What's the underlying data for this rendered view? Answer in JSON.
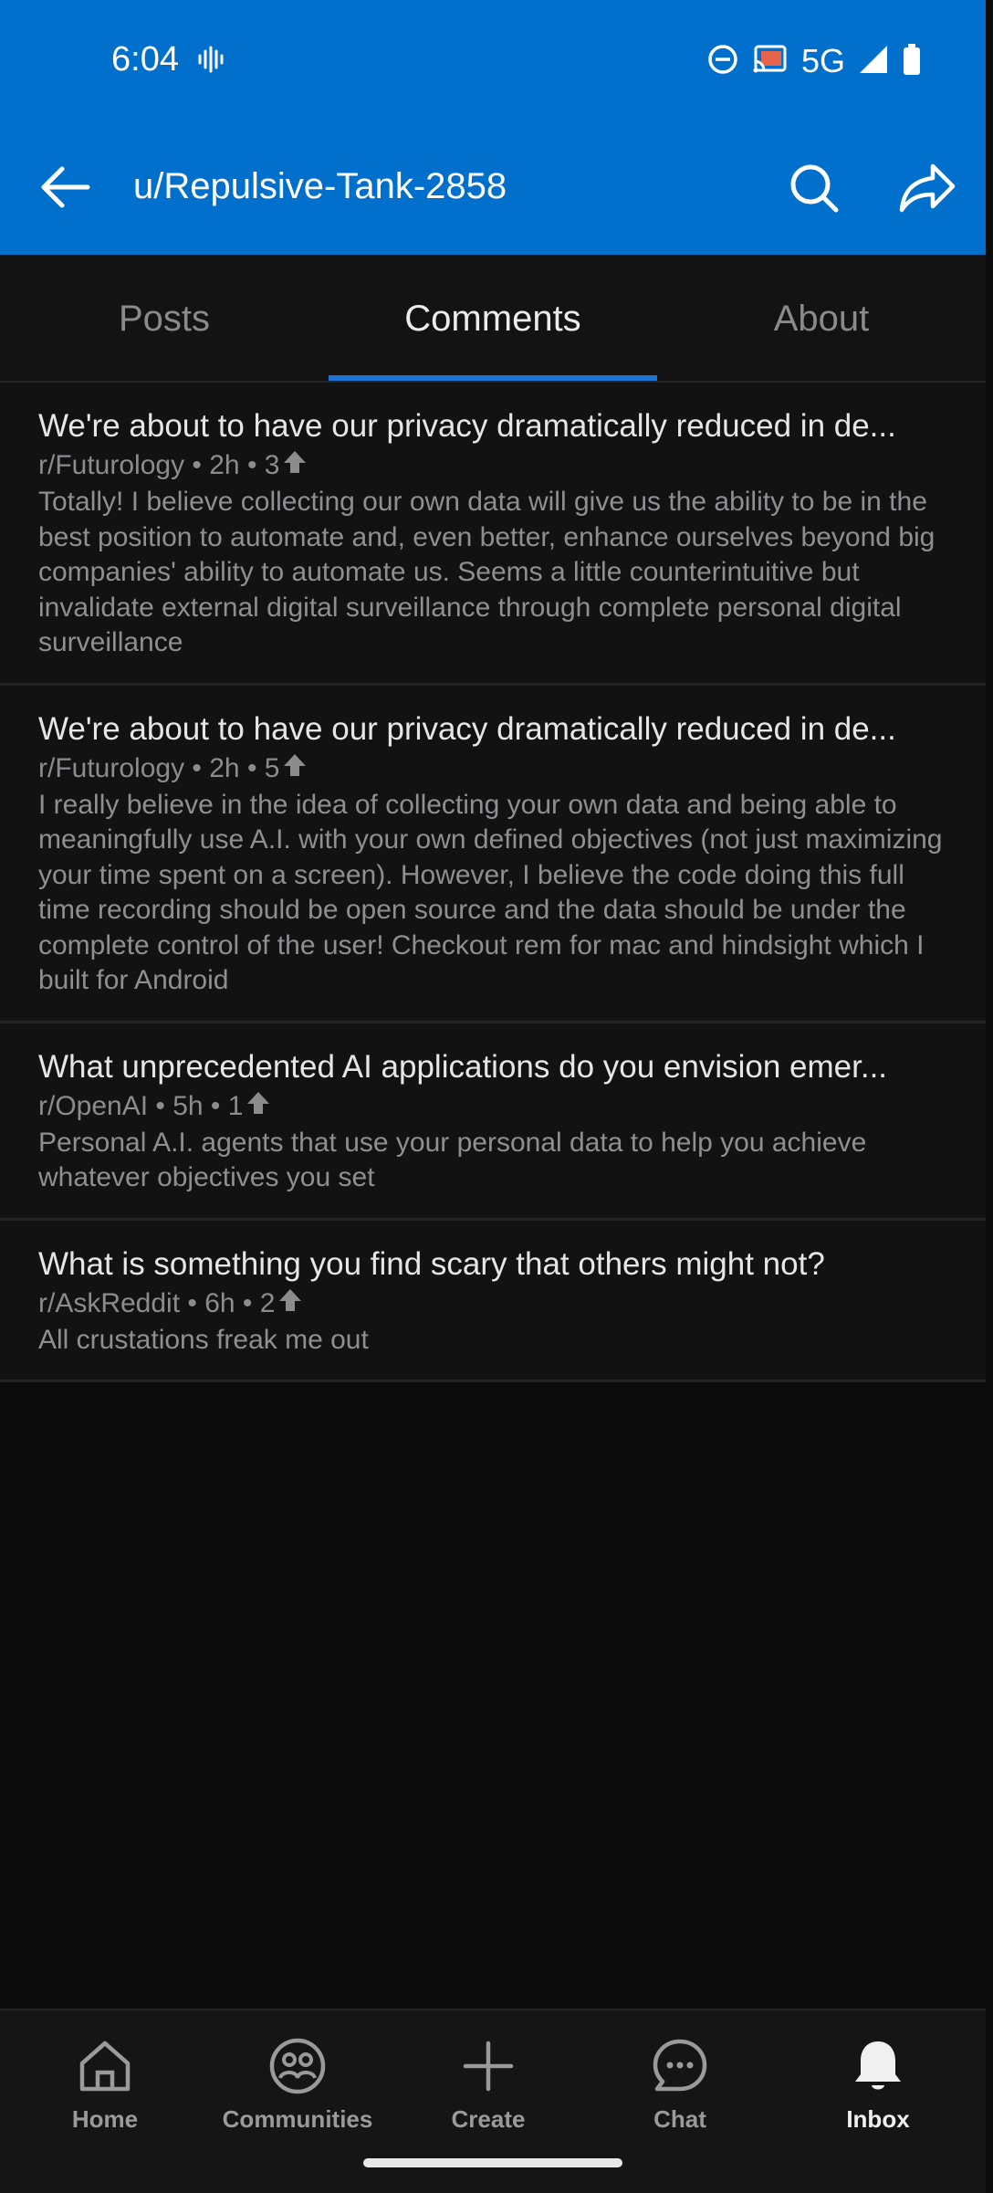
{
  "status": {
    "time": "6:04",
    "network": "5G"
  },
  "header": {
    "title": "u/Repulsive-Tank-2858"
  },
  "tabs": [
    {
      "label": "Posts"
    },
    {
      "label": "Comments"
    },
    {
      "label": "About"
    }
  ],
  "comments": [
    {
      "title": "We're about to have our privacy dramatically reduced in de...",
      "meta": "r/Futurology • 2h • 3",
      "body": "Totally! I believe collecting our own data will give us the ability to be in the best position to automate and, even better, enhance ourselves beyond big companies' ability to automate us. Seems a little counterintuitive but invalidate external digital surveillance through complete personal digital surveillance"
    },
    {
      "title": "We're about to have our privacy dramatically reduced in de...",
      "meta": "r/Futurology • 2h • 5",
      "body": "I really believe in the idea of collecting your own data and being able to meaningfully use A.I. with your own defined objectives (not just maximizing your time spent on a screen). However, I believe the code doing this full time recording should be open source and the data should be under the complete control of the user!  Checkout rem for mac and hindsight which I built for Android"
    },
    {
      "title": "What unprecedented AI applications do you envision emer...",
      "meta": "r/OpenAI • 5h • 1",
      "body": "Personal A.I. agents that use your personal data to help you achieve whatever objectives you set"
    },
    {
      "title": "What is something you find scary that others might not?",
      "meta": "r/AskReddit • 6h • 2",
      "body": "All crustations freak me out"
    }
  ],
  "nav": [
    {
      "label": "Home",
      "icon": "home-icon"
    },
    {
      "label": "Communities",
      "icon": "communities-icon"
    },
    {
      "label": "Create",
      "icon": "plus-icon"
    },
    {
      "label": "Chat",
      "icon": "chat-icon"
    },
    {
      "label": "Inbox",
      "icon": "bell-icon"
    }
  ],
  "colors": {
    "header": "#0070cc",
    "accent": "#1e74d2",
    "background": "#0b0b0c"
  }
}
